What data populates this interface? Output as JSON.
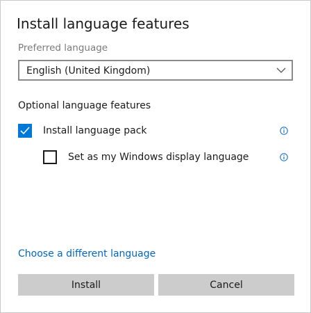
{
  "dialog": {
    "title": "Install language features",
    "preferred_label": "Preferred language",
    "preferred_value": "English (United Kingdom)",
    "optional_section": "Optional language features",
    "options": [
      {
        "label": "Install language pack",
        "checked": true
      },
      {
        "label": "Set as my Windows display language",
        "checked": false
      }
    ],
    "link": "Choose a different language",
    "install_button": "Install",
    "cancel_button": "Cancel"
  },
  "colors": {
    "accent": "#0078d7",
    "link": "#0067c0",
    "button_bg": "#cccccc"
  }
}
